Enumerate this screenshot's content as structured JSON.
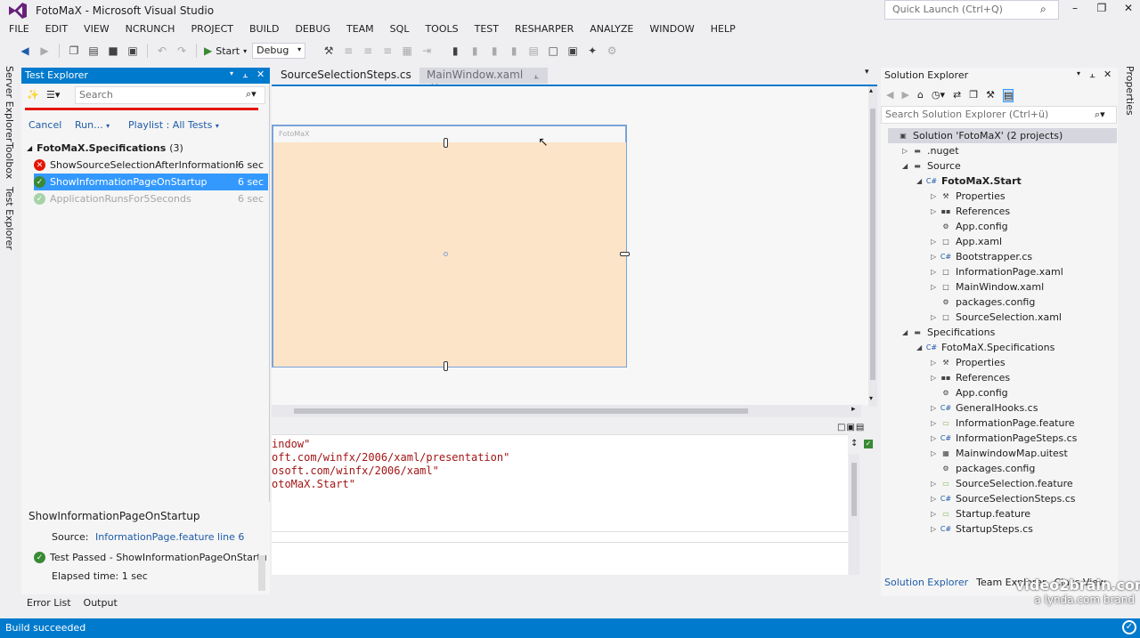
{
  "window": {
    "title": "FotoMaX - Microsoft Visual Studio",
    "quick_launch_placeholder": "Quick Launch (Ctrl+Q)",
    "accent": "#007acc"
  },
  "menu": [
    "FILE",
    "EDIT",
    "VIEW",
    "NCRUNCH",
    "PROJECT",
    "BUILD",
    "DEBUG",
    "TEAM",
    "SQL",
    "TOOLS",
    "TEST",
    "RESHARPER",
    "ANALYZE",
    "WINDOW",
    "HELP"
  ],
  "toolbar": {
    "start_label": "Start",
    "config_value": "Debug"
  },
  "left_rail": [
    "Server Explorer",
    "Toolbox",
    "Test Explorer"
  ],
  "right_rail": [
    "Properties"
  ],
  "test_explorer": {
    "title": "Test Explorer",
    "search_placeholder": "Search",
    "cancel_label": "Cancel",
    "run_label": "Run...",
    "playlist_label": "Playlist : All Tests",
    "group_label": "FotoMaX.Specifications",
    "group_count": "(3)",
    "tests": [
      {
        "name": "ShowSourceSelectionAfterInformationP...",
        "duration": "6 sec",
        "status": "failed"
      },
      {
        "name": "ShowInformationPageOnStartup",
        "duration": "6 sec",
        "status": "passed"
      },
      {
        "name": "ApplicationRunsFor5Seconds",
        "duration": "6 sec",
        "status": "passed"
      }
    ],
    "detail": {
      "title": "ShowInformationPageOnStartup",
      "source_label": "Source:",
      "source_link": "InformationPage.feature line 6",
      "result": "Test Passed - ShowInformationPageOnStartu",
      "elapsed": "Elapsed time: 1 sec"
    }
  },
  "editor": {
    "tabs": [
      {
        "label": "SourceSelectionSteps.cs",
        "active": false
      },
      {
        "label": "MainWindow.xaml",
        "active": true
      }
    ],
    "designer_window_title": "FotoMaX",
    "xaml_lines": [
      "indow\"",
      "oft.com/winfx/2006/xaml/presentation\"",
      "osoft.com/winfx/2006/xaml\"",
      "otoMaX.Start\""
    ]
  },
  "solution_explorer": {
    "title": "Solution Explorer",
    "search_placeholder": "Search Solution Explorer (Ctrl+ü)",
    "tree": [
      {
        "label": "Solution 'FotoMaX' (2 projects)",
        "depth": 0,
        "icon": "solution-icon",
        "arrow": "",
        "selected": true
      },
      {
        "label": ".nuget",
        "depth": 1,
        "icon": "folder-icon",
        "arrow": "right"
      },
      {
        "label": "Source",
        "depth": 1,
        "icon": "folder-icon",
        "arrow": "down"
      },
      {
        "label": "FotoMaX.Start",
        "depth": 2,
        "icon": "csharp-project-icon",
        "arrow": "down",
        "bold": true
      },
      {
        "label": "Properties",
        "depth": 3,
        "icon": "wrench-icon",
        "arrow": "right"
      },
      {
        "label": "References",
        "depth": 3,
        "icon": "references-icon",
        "arrow": "right"
      },
      {
        "label": "App.config",
        "depth": 3,
        "icon": "config-icon",
        "arrow": ""
      },
      {
        "label": "App.xaml",
        "depth": 3,
        "icon": "xaml-icon",
        "arrow": "right"
      },
      {
        "label": "Bootstrapper.cs",
        "depth": 3,
        "icon": "csharp-file-icon",
        "arrow": "right"
      },
      {
        "label": "InformationPage.xaml",
        "depth": 3,
        "icon": "xaml-icon",
        "arrow": "right"
      },
      {
        "label": "MainWindow.xaml",
        "depth": 3,
        "icon": "xaml-icon",
        "arrow": "right"
      },
      {
        "label": "packages.config",
        "depth": 3,
        "icon": "config-icon",
        "arrow": ""
      },
      {
        "label": "SourceSelection.xaml",
        "depth": 3,
        "icon": "xaml-icon",
        "arrow": "right"
      },
      {
        "label": "Specifications",
        "depth": 1,
        "icon": "folder-icon",
        "arrow": "down"
      },
      {
        "label": "FotoMaX.Specifications",
        "depth": 2,
        "icon": "csharp-project-icon",
        "arrow": "down"
      },
      {
        "label": "Properties",
        "depth": 3,
        "icon": "wrench-icon",
        "arrow": "right"
      },
      {
        "label": "References",
        "depth": 3,
        "icon": "references-icon",
        "arrow": "right"
      },
      {
        "label": "App.config",
        "depth": 3,
        "icon": "config-icon",
        "arrow": ""
      },
      {
        "label": "GeneralHooks.cs",
        "depth": 3,
        "icon": "csharp-file-icon",
        "arrow": "right"
      },
      {
        "label": "InformationPage.feature",
        "depth": 3,
        "icon": "feature-icon",
        "arrow": "right"
      },
      {
        "label": "InformationPageSteps.cs",
        "depth": 3,
        "icon": "csharp-file-icon",
        "arrow": "right"
      },
      {
        "label": "MainwindowMap.uitest",
        "depth": 3,
        "icon": "uitest-icon",
        "arrow": "right"
      },
      {
        "label": "packages.config",
        "depth": 3,
        "icon": "config-icon",
        "arrow": ""
      },
      {
        "label": "SourceSelection.feature",
        "depth": 3,
        "icon": "feature-icon",
        "arrow": "right"
      },
      {
        "label": "SourceSelectionSteps.cs",
        "depth": 3,
        "icon": "csharp-file-icon",
        "arrow": "right"
      },
      {
        "label": "Startup.feature",
        "depth": 3,
        "icon": "feature-icon",
        "arrow": "right"
      },
      {
        "label": "StartupSteps.cs",
        "depth": 3,
        "icon": "csharp-file-icon",
        "arrow": "right"
      }
    ],
    "bottom_tabs": [
      "Solution Explorer",
      "Team Explorer",
      "Class View"
    ]
  },
  "bottom_tabs": [
    "Error List",
    "Output"
  ],
  "watermark": {
    "line1": "video2brain.com",
    "line2": "a lynda.com brand"
  },
  "status": {
    "text": "Build succeeded"
  }
}
